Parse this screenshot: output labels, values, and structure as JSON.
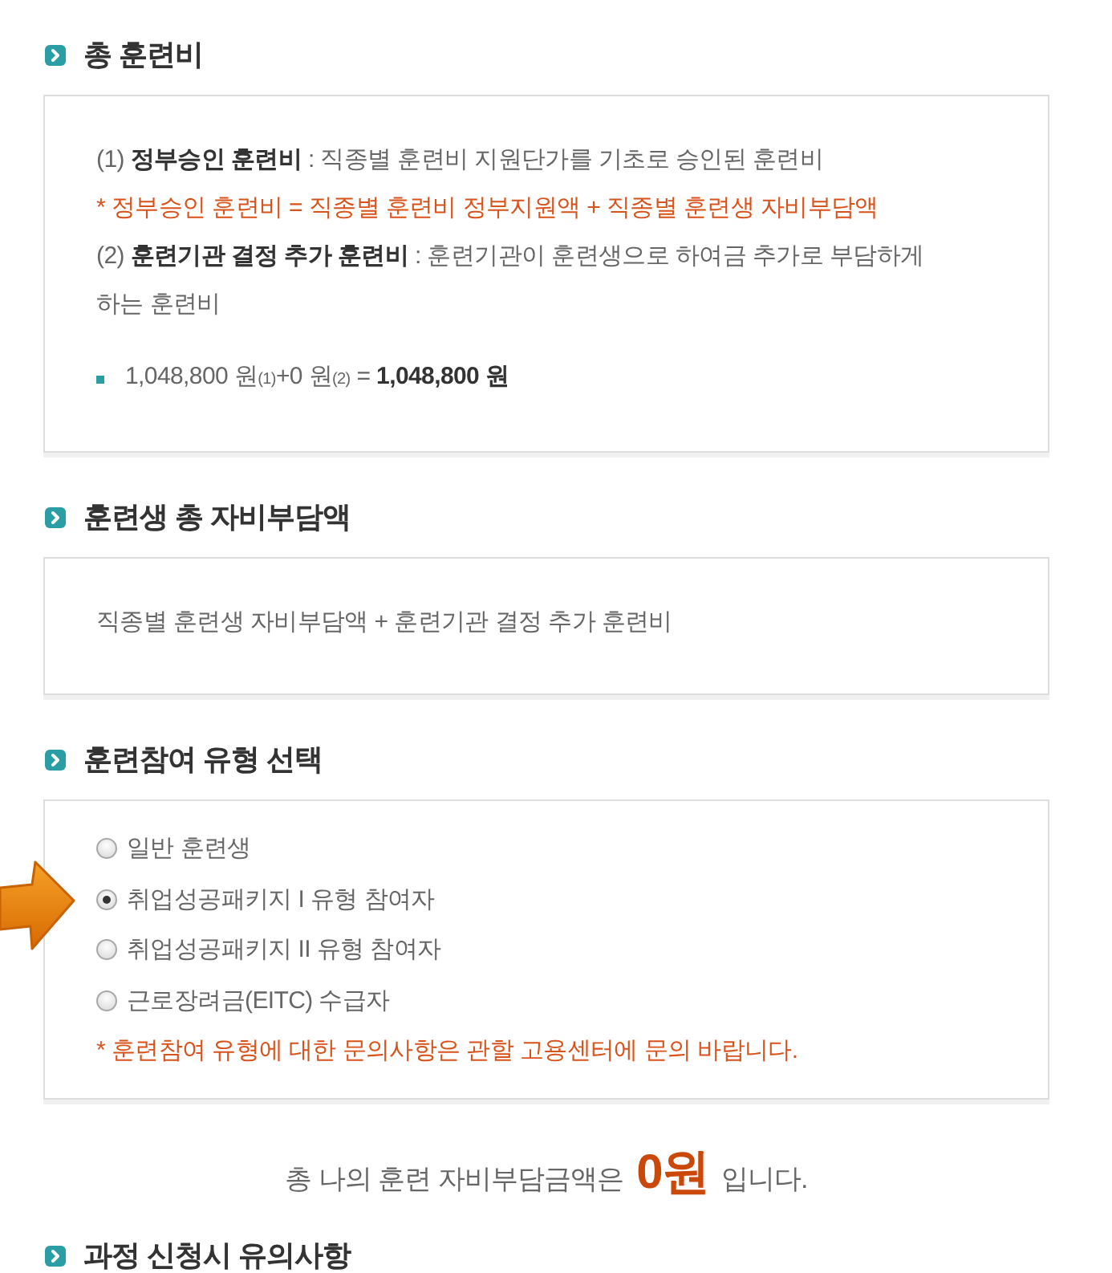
{
  "sections": [
    {
      "kind": "info",
      "title": "총 훈련비",
      "lines": [
        {
          "kind": "text",
          "text": "(1) **정부승인 훈련비** : 직종별 훈련비 지원단가를 기초로 승인된 훈련비"
        },
        {
          "kind": "note",
          "text": "* 정부승인 훈련비 = 직종별 훈련비 정부지원액 + 직종별 훈련생 자비부담액"
        },
        {
          "kind": "text",
          "text": "(2) **훈련기관 결정 추가 훈련비** : 훈련기관이 훈련생으로 하여금 추가로 부담하게 하는 훈련비"
        },
        {
          "kind": "bullet",
          "text": "1,048,800 원$_{(1)}$+0 원$_{(2)}$ = **1,048,800 원**"
        }
      ]
    },
    {
      "kind": "info",
      "title": "훈련생 총 자비부담액",
      "lines": [
        {
          "kind": "text",
          "text": "직종별 훈련생 자비부담액 + 훈련기관 결정 추가 훈련비"
        }
      ]
    },
    {
      "kind": "choice",
      "title": "훈련참여 유형 선택",
      "options": [
        {
          "label": "일반 훈련생",
          "selected": false
        },
        {
          "label": "취업성공패키지 I 유형 참여자",
          "selected": true
        },
        {
          "label": "취업성공패키지 II 유형 참여자",
          "selected": false
        },
        {
          "label": "근로장려금(EITC) 수급자",
          "selected": false
        }
      ],
      "note": "* 훈련참여 유형에 대한 문의사항은 관할 고용센터에 문의 바랍니다."
    },
    {
      "kind": "summary",
      "text": "총 나의 훈련 자비부담금액은 **0원** 입니다."
    },
    {
      "kind": "heading",
      "title": "과정 신청시 유의사항"
    }
  ]
}
